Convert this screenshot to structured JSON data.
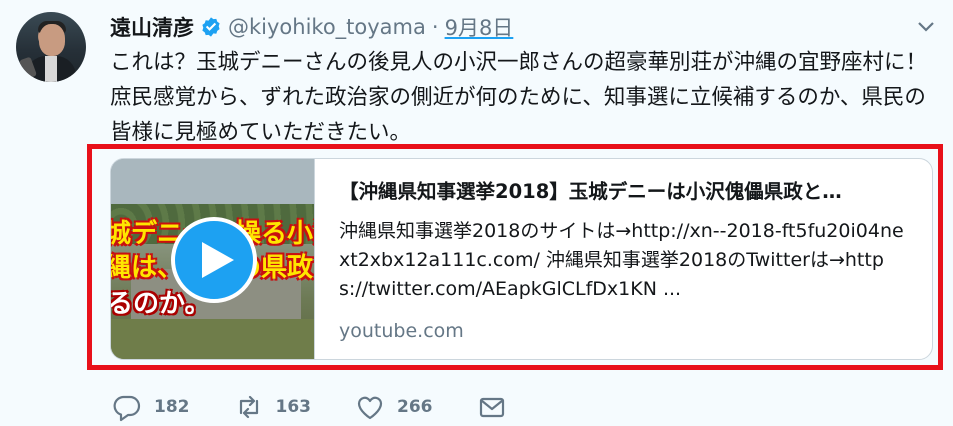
{
  "tweet": {
    "author_name": "遠山清彦",
    "handle": "@kiyohiko_toyama",
    "separator": "·",
    "date": "9月8日",
    "text": "これは？玉城デニーさんの後見人の小沢一郎さんの超豪華別荘が沖縄の宜野座村に！庶民感覚から、ずれた政治家の側近が何のために、知事選に立候補するのか、県民の皆様に見極めていただきたい。"
  },
  "card": {
    "title": "【沖縄県知事選挙2018】玉城デニーは小沢傀儡県政と…",
    "description": "沖縄県知事選挙2018のサイトは→http://xn--2018-ft5fu20i04next2xbx12a111c.com/ 沖縄県知事選挙2018のTwitterは→https://twitter.com/AEapkGlCLfDx1KN ...",
    "domain": "youtube.com",
    "thumb_overlay_lines": [
      "城デニーを操る小沢一",
      "縄は、小沢の県政と",
      "るのか。"
    ]
  },
  "actions": {
    "reply_count": "182",
    "retweet_count": "163",
    "like_count": "266"
  },
  "icons": {
    "verified": "verified-badge-icon",
    "caret": "chevron-down-icon",
    "play": "play-icon",
    "reply": "reply-icon",
    "retweet": "retweet-icon",
    "like": "heart-icon",
    "message": "envelope-icon"
  },
  "colors": {
    "accent": "#1da1f2",
    "highlight_border": "#e8101a",
    "muted": "#657786"
  }
}
